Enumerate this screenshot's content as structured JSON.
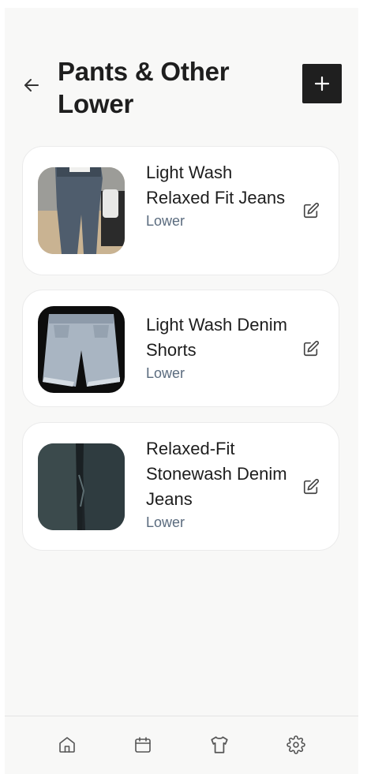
{
  "header": {
    "title": "Pants & Other Lower",
    "back_icon": "arrow-left-icon",
    "add_icon": "plus-icon"
  },
  "items": [
    {
      "name": "Light Wash Relaxed Fit Jeans",
      "category": "Lower",
      "edit_icon": "edit-icon"
    },
    {
      "name": "Light Wash Denim Shorts",
      "category": "Lower",
      "edit_icon": "edit-icon"
    },
    {
      "name": "Relaxed-Fit Stonewash Denim Jeans",
      "category": "Lower",
      "edit_icon": "edit-icon"
    }
  ],
  "bottom_nav": {
    "items": [
      {
        "icon": "home-icon"
      },
      {
        "icon": "calendar-icon"
      },
      {
        "icon": "shirt-icon"
      },
      {
        "icon": "gear-icon"
      }
    ]
  },
  "colors": {
    "background": "#f8f8f7",
    "card": "#ffffff",
    "title": "#1e1e1e",
    "category": "#5a6b7e",
    "add_button": "#1f1f1f"
  }
}
